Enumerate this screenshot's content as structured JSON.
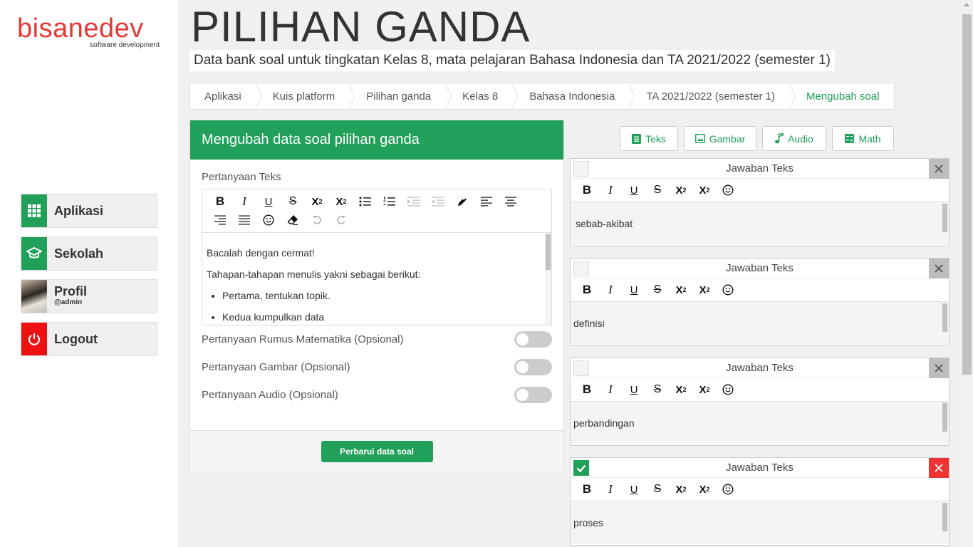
{
  "brand": {
    "name": "bisanedev",
    "tagline": "software development"
  },
  "nav": {
    "aplikasi": "Aplikasi",
    "sekolah": "Sekolah",
    "profil_name": "Profil",
    "profil_user": "@admin",
    "logout": "Logout"
  },
  "header": {
    "title": "PILIHAN GANDA",
    "subtitle": "Data bank soal untuk tingkatan Kelas 8, mata pelajaran Bahasa Indonesia dan TA 2021/2022 (semester 1)"
  },
  "breadcrumb": [
    "Aplikasi",
    "Kuis platform",
    "Pilihan ganda",
    "Kelas 8",
    "Bahasa Indonesia",
    "TA 2021/2022 (semester 1)",
    "Mengubah soal"
  ],
  "form": {
    "heading": "Mengubah data soal pilihan ganda",
    "question_label": "Pertanyaan Teks",
    "question_content": {
      "p1": "Bacalah dengan cermat!",
      "p2": "Tahapan-tahapan menulis yakni sebagai berikut:",
      "li1": "Pertama, tentukan topik.",
      "li2": "Kedua kumpulkan data"
    },
    "toggle_math": "Pertanyaan Rumus Matematika (Opsional)",
    "toggle_image": "Pertanyaan Gambar (Opsional)",
    "toggle_audio": "Pertanyaan Audio (Opsional)",
    "submit": "Perbarui data soal"
  },
  "answer_types": [
    "Teks",
    "Gambar",
    "Audio",
    "Math"
  ],
  "answers": [
    {
      "title": "Jawaban Teks",
      "text": "sebab-akibat",
      "correct": false
    },
    {
      "title": "Jawaban Teks",
      "text": "definisi",
      "correct": false
    },
    {
      "title": "Jawaban Teks",
      "text": "perbandingan",
      "correct": false
    },
    {
      "title": "Jawaban Teks",
      "text": "proses",
      "correct": true
    }
  ],
  "colors": {
    "primary": "#21a05a",
    "danger": "#ee1111",
    "brand": "#e53935"
  },
  "icons": [
    "apps-grid-icon",
    "graduation-cap-icon",
    "power-icon",
    "file-text-icon",
    "image-icon",
    "music-note-icon",
    "calculator-icon",
    "close-icon",
    "check-icon"
  ]
}
